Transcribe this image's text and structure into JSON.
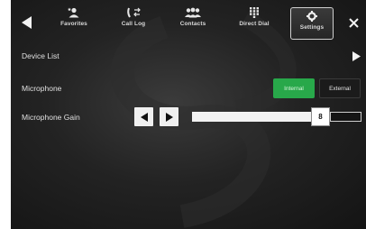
{
  "nav": {
    "tabs": [
      {
        "label": "Favorites",
        "icon": "favorites-icon"
      },
      {
        "label": "Call Log",
        "icon": "call-log-icon"
      },
      {
        "label": "Contacts",
        "icon": "contacts-icon"
      },
      {
        "label": "Direct Dial",
        "icon": "direct-dial-icon"
      },
      {
        "label": "Settings",
        "icon": "gear-icon",
        "selected": true
      }
    ],
    "back_icon": "back-arrow-icon",
    "close_icon": "close-icon"
  },
  "settings": {
    "device_list_label": "Device List",
    "microphone_label": "Microphone",
    "microphone_options": [
      "Internal",
      "External"
    ],
    "microphone_selected": "Internal",
    "gain_label": "Microphone Gain",
    "gain_value": "8",
    "gain_fraction": 0.79
  },
  "colors": {
    "selected_option": "#28a84a",
    "background": "#1e1e1e"
  }
}
